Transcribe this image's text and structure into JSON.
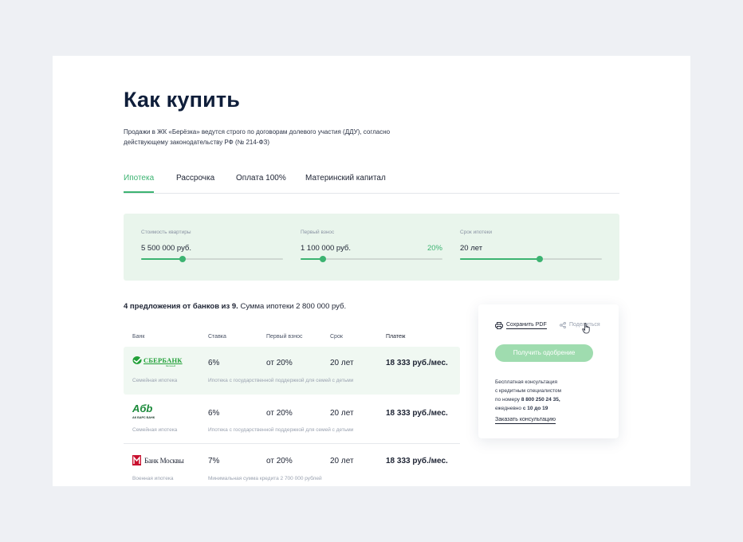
{
  "page": {
    "title": "Как купить",
    "intro_line1": "Продажи в ЖК «Берёзка» ведутся строго по договорам долевого участия (ДДУ), согласно",
    "intro_line2": "действующему законодательству РФ (№ 214-ФЗ)"
  },
  "tabs": [
    {
      "label": "Ипотека",
      "active": true
    },
    {
      "label": "Рассрочка",
      "active": false
    },
    {
      "label": "Оплата 100%",
      "active": false
    },
    {
      "label": "Материнский капитал",
      "active": false
    }
  ],
  "calculator": {
    "price": {
      "label": "Стоимость квартиры",
      "value": "5 500 000 руб.",
      "level": 0.29
    },
    "down_payment": {
      "label": "Первый взнос",
      "value": "1 100 000 руб.",
      "percent": "20%",
      "level": 0.16
    },
    "term": {
      "label": "Срок ипотеки",
      "value": "20 лет",
      "level": 0.56
    }
  },
  "summary": {
    "bold": "4 предложения от банков из 9.",
    "rest": " Сумма ипотеки 2 800 000 руб."
  },
  "offers_header": {
    "bank": "Банк",
    "rate": "Ставка",
    "down": "Первый взнос",
    "term": "Срок",
    "payment": "Платеж"
  },
  "offers": [
    {
      "bank_name": "СБЕРБАНК",
      "logo_icon": "sberbank-logo",
      "rate": "6%",
      "down": "от 20%",
      "term": "20 лет",
      "payment": "18 333 руб./мес.",
      "program": "Семейная ипотека",
      "note": "Ипотека с государственной поддержкой для семей с детьми"
    },
    {
      "bank_name": "АК БАРС БАНК",
      "logo_icon": "ak-bars-logo",
      "rate": "6%",
      "down": "от 20%",
      "term": "20 лет",
      "payment": "18 333 руб./мес.",
      "program": "Семейная ипотека",
      "note": "Ипотека с государственной поддержкой для семей с детьми"
    },
    {
      "bank_name": "Банк Москвы",
      "logo_icon": "bank-moskvy-logo",
      "rate": "7%",
      "down": "от 20%",
      "term": "20 лет",
      "payment": "18 333 руб./мес.",
      "program": "Военная ипотека",
      "note": "Минимальная сумма кредита 2 700 000 рублей"
    }
  ],
  "side": {
    "save_pdf": "Сохранить PDF",
    "share": "Поделиться",
    "approve_button": "Получить одобрение",
    "consult_l1": "Бесплатная консультация",
    "consult_l2": "с кредитным специалистом",
    "consult_l3_prefix": "по номеру ",
    "phone": "8 800 250 24 35,",
    "consult_l4_prefix": "ежедневно ",
    "hours": "с 10 до 19",
    "consult_link": "Заказать консультацию"
  },
  "colors": {
    "accent": "#3cb371",
    "calc_bg": "#e9f5ec",
    "button_bg": "#9fdcaf",
    "page_bg": "#eef0f4",
    "title": "#0f1e3a"
  }
}
